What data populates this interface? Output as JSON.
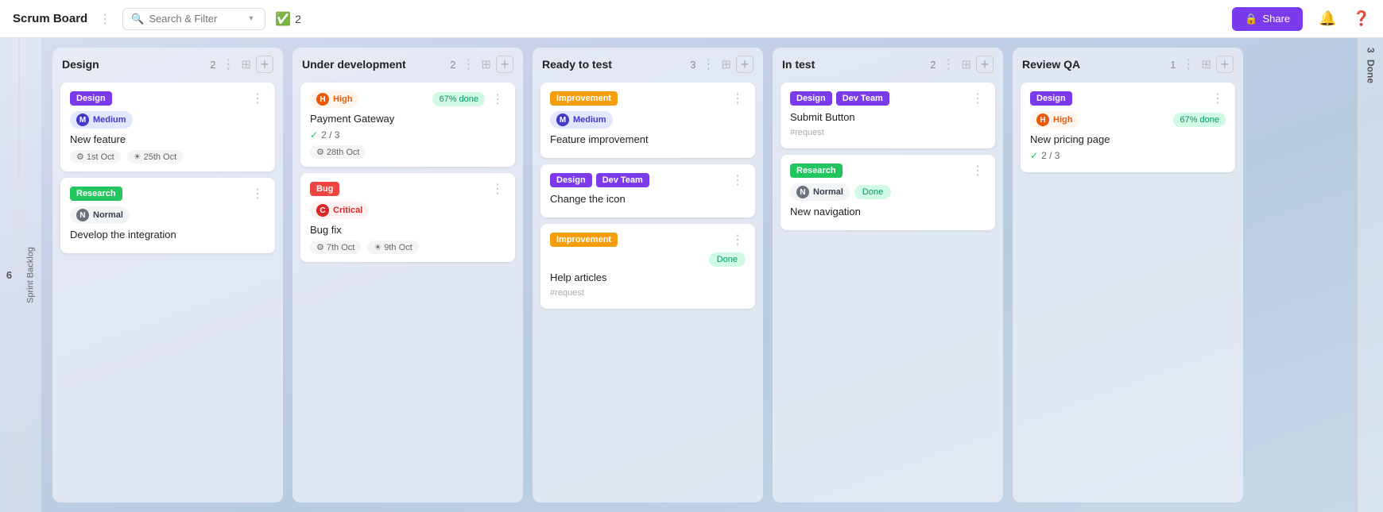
{
  "header": {
    "title": "Scrum Board",
    "search_placeholder": "Search & Filter",
    "task_count": "2",
    "share_label": "Share"
  },
  "columns": [
    {
      "id": "design",
      "title": "Design",
      "count": "2",
      "cards": [
        {
          "id": "design-card-1",
          "tag": "Design",
          "tag_class": "tag-design",
          "badge_text": "Medium",
          "badge_letter": "M",
          "badge_letter_class": "letter-m",
          "badge_class": "badge-medium",
          "title": "New feature",
          "dates": [
            "1st Oct",
            "25th Oct"
          ]
        },
        {
          "id": "design-card-2",
          "tag": "Research",
          "tag_class": "tag-research",
          "badge_text": "Normal",
          "badge_letter": "N",
          "badge_letter_class": "letter-n",
          "badge_class": "badge-normal",
          "title": "Develop the integration",
          "dates": []
        }
      ]
    },
    {
      "id": "under-development",
      "title": "Under development",
      "count": "2",
      "cards": [
        {
          "id": "ud-card-1",
          "tag": "High",
          "tag_class": "",
          "badge_letter": "H",
          "badge_letter_class": "letter-h",
          "badge_class": "badge-high",
          "progress": "67% done",
          "title": "Payment Gateway",
          "checklist": "2 / 3",
          "dates": [
            "28th Oct"
          ]
        },
        {
          "id": "ud-card-2",
          "tag": "Bug",
          "tag_class": "tag-bug",
          "badge_text": "Critical",
          "badge_letter": "C",
          "badge_letter_class": "letter-c",
          "badge_class": "badge-critical",
          "title": "Bug fix",
          "dates": [
            "7th Oct",
            "9th Oct"
          ]
        }
      ]
    },
    {
      "id": "ready-to-test",
      "title": "Ready to test",
      "count": "3",
      "cards": [
        {
          "id": "rtt-card-1",
          "tags": [
            "Improvement"
          ],
          "tag_classes": [
            "tag-improvement"
          ],
          "badge_text": "Medium",
          "badge_letter": "M",
          "badge_letter_class": "letter-m",
          "badge_class": "badge-medium",
          "title": "Feature improvement",
          "dates": []
        },
        {
          "id": "rtt-card-2",
          "tags": [
            "Design",
            "Dev Team"
          ],
          "tag_classes": [
            "tag-design",
            "tag-dev-team"
          ],
          "title": "Change the icon",
          "dates": []
        },
        {
          "id": "rtt-card-3",
          "tags": [
            "Improvement"
          ],
          "tag_classes": [
            "tag-improvement"
          ],
          "done_badge": "Done",
          "title": "Help articles",
          "subtitle": "#request",
          "dates": []
        }
      ]
    },
    {
      "id": "in-test",
      "title": "In test",
      "count": "2",
      "cards": [
        {
          "id": "it-card-1",
          "tags": [
            "Design",
            "Dev Team"
          ],
          "tag_classes": [
            "tag-design",
            "tag-dev-team"
          ],
          "title": "Submit Button",
          "subtitle": "#request",
          "dates": []
        },
        {
          "id": "it-card-2",
          "tags": [
            "Research"
          ],
          "tag_classes": [
            "tag-research"
          ],
          "badge_text": "Normal",
          "badge_letter": "N",
          "badge_letter_class": "letter-n",
          "badge_class": "badge-normal",
          "done_badge": "Done",
          "title": "New navigation",
          "dates": []
        }
      ]
    },
    {
      "id": "review-qa",
      "title": "Review QA",
      "count": "1",
      "cards": [
        {
          "id": "rqa-card-1",
          "tag": "Design",
          "tag_class": "tag-design",
          "badge_text": "High",
          "badge_letter": "H",
          "badge_letter_class": "letter-h",
          "badge_class": "badge-high",
          "progress": "67% done",
          "title": "New pricing page",
          "checklist": "2 / 3",
          "dates": []
        }
      ]
    }
  ],
  "sprint_backlog": "Sprint Backlog",
  "left_number": "6",
  "done_label": "Done",
  "done_count": "3"
}
